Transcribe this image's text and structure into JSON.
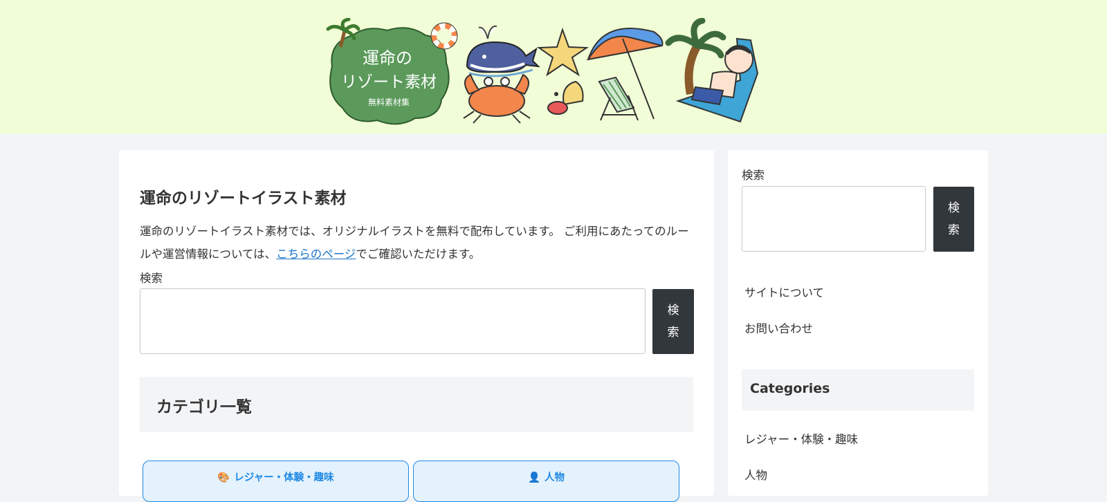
{
  "header": {
    "logo_lines": [
      "運命の",
      "リゾート素材",
      "無料素材集"
    ]
  },
  "main": {
    "title": "運命のリゾートイラスト素材",
    "intro_before": "運命のリゾートイラスト素材では、オリジナルイラストを無料で配布しています。 ご利用にあたってのルールや運営情報については、",
    "intro_link": "こちらのページ",
    "intro_after": "でご確認いただけます。",
    "search": {
      "label": "検索",
      "button": "検索",
      "value": "",
      "placeholder": ""
    },
    "categories_heading": "カテゴリ一覧",
    "category_cards": [
      {
        "label": "レジャー・体験・趣味",
        "icon": "palette-icon",
        "glyph": "🎨"
      },
      {
        "label": "人物",
        "icon": "person-icon",
        "glyph": "👤"
      }
    ]
  },
  "sidebar": {
    "search": {
      "label": "検索",
      "button": "検索",
      "value": "",
      "placeholder": ""
    },
    "links": [
      "サイトについて",
      "お問い合わせ"
    ],
    "categories_heading": "Categories",
    "categories": [
      "レジャー・体験・趣味",
      "人物"
    ]
  },
  "colors": {
    "header_bg": "#f1fdd6",
    "page_bg": "#f3f4f6",
    "button_bg": "#32373c",
    "link": "#1a73c8",
    "card_border": "#1e88e5",
    "card_bg": "#e3f2fd"
  }
}
